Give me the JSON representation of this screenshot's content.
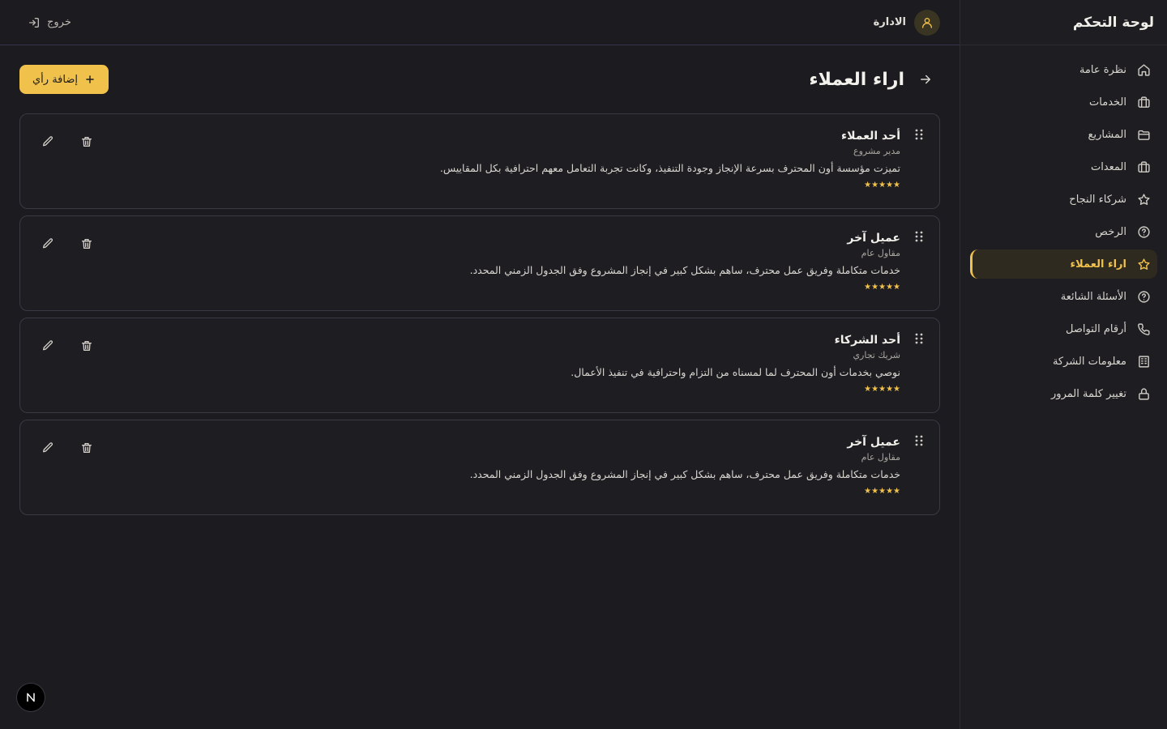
{
  "sidebar": {
    "brand": "لوحة التحكم",
    "items": [
      {
        "label": "نظرة عامة",
        "icon": "home-icon"
      },
      {
        "label": "الخدمات",
        "icon": "briefcase-icon"
      },
      {
        "label": "المشاريع",
        "icon": "folder-icon"
      },
      {
        "label": "المعدات",
        "icon": "briefcase-icon"
      },
      {
        "label": "شركاء النجاح",
        "icon": "star-icon"
      },
      {
        "label": "الرخص",
        "icon": "help-circle-icon"
      },
      {
        "label": "اراء العملاء",
        "icon": "star-icon",
        "active": true
      },
      {
        "label": "الأسئلة الشائعة",
        "icon": "help-circle-icon"
      },
      {
        "label": "أرقام التواصل",
        "icon": "phone-icon"
      },
      {
        "label": "معلومات الشركة",
        "icon": "building-icon"
      },
      {
        "label": "تغيير كلمة المرور",
        "icon": "lock-icon"
      }
    ]
  },
  "topbar": {
    "user_name": "الادارة",
    "logout_label": "خروج"
  },
  "page": {
    "title": "اراء العملاء",
    "add_label": "إضافة رأي"
  },
  "testimonials": [
    {
      "name": "أحد العملاء",
      "role": "مدير مشروع",
      "text": "تميزت مؤسسة أون المحترف بسرعة الإنجاز وجودة التنفيذ، وكانت تجربة التعامل معهم احترافية بكل المقاييس.",
      "stars": "★★★★★"
    },
    {
      "name": "عميل آخر",
      "role": "مقاول عام",
      "text": "خدمات متكاملة وفريق عمل محترف، ساهم بشكل كبير في إنجاز المشروع وفق الجدول الزمني المحدد.",
      "stars": "★★★★★"
    },
    {
      "name": "أحد الشركاء",
      "role": "شريك تجاري",
      "text": "نوصي بخدمات أون المحترف لما لمسناه من التزام واحترافية في تنفيذ الأعمال.",
      "stars": "★★★★★"
    },
    {
      "name": "عميل آخر",
      "role": "مقاول عام",
      "text": "خدمات متكاملة وفريق عمل محترف، ساهم بشكل كبير في إنجاز المشروع وفق الجدول الزمني المحدد.",
      "stars": "★★★★★"
    }
  ],
  "colors": {
    "accent": "#f0c14b",
    "background": "#1c1b1f",
    "card_border": "#3a3945"
  }
}
